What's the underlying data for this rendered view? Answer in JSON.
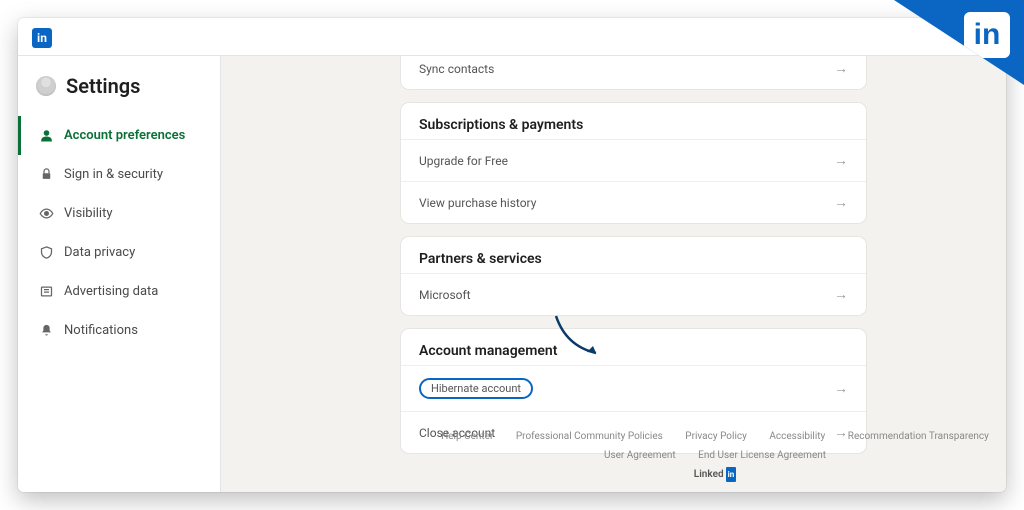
{
  "brand": {
    "small_logo_text": "in",
    "corner_text": "in",
    "footer_brand": "Linked",
    "footer_brand_box": "in"
  },
  "page": {
    "title": "Settings"
  },
  "nav": {
    "accountPreferences": "Account preferences",
    "signInSecurity": "Sign in & security",
    "visibility": "Visibility",
    "dataPrivacy": "Data privacy",
    "advertisingData": "Advertising data",
    "notifications": "Notifications"
  },
  "cards": {
    "syncContacts": "Sync contacts",
    "subscriptionsPayments": {
      "title": "Subscriptions & payments",
      "upgrade": "Upgrade for Free",
      "history": "View purchase history"
    },
    "partnersServices": {
      "title": "Partners & services",
      "microsoft": "Microsoft"
    },
    "accountManagement": {
      "title": "Account management",
      "hibernate": "Hibernate account",
      "close": "Close account"
    }
  },
  "footer": {
    "help": "Help Center",
    "community": "Professional Community Policies",
    "privacy": "Privacy Policy",
    "accessibility": "Accessibility",
    "recommendation": "Recommendation Transparency",
    "userAgreement": "User Agreement",
    "eula": "End User License Agreement"
  }
}
